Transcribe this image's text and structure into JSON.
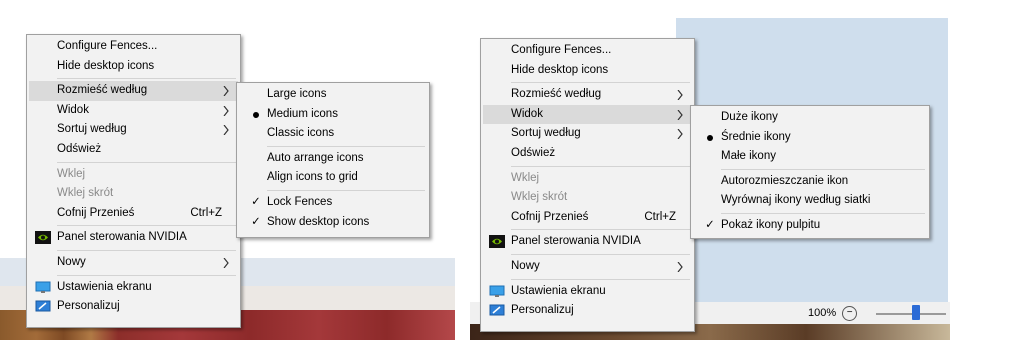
{
  "left": {
    "main_menu": {
      "configure": "Configure Fences...",
      "hide_icons": "Hide desktop icons",
      "sort_by_size": "Rozmieść według",
      "view": "Widok",
      "sort_by": "Sortuj według",
      "refresh": "Odśwież",
      "paste": "Wklej",
      "paste_shortcut": "Wklej skrót",
      "undo_move": "Cofnij Przenieś",
      "undo_shortcut": "Ctrl+Z",
      "nvidia": "Panel sterowania NVIDIA",
      "new": "Nowy",
      "display_settings": "Ustawienia ekranu",
      "personalize": "Personalizuj"
    },
    "submenu": {
      "large": "Large icons",
      "medium": "Medium icons",
      "classic": "Classic icons",
      "auto_arrange": "Auto arrange icons",
      "align_grid": "Align icons to grid",
      "lock_fences": "Lock Fences",
      "show_desktop": "Show desktop icons",
      "check_mark": "✓"
    }
  },
  "right": {
    "main_menu": {
      "configure": "Configure Fences...",
      "hide_icons": "Hide desktop icons",
      "sort_by_size": "Rozmieść według",
      "view": "Widok",
      "sort_by": "Sortuj według",
      "refresh": "Odśwież",
      "paste": "Wklej",
      "paste_shortcut": "Wklej skrót",
      "undo_move": "Cofnij Przenieś",
      "undo_shortcut": "Ctrl+Z",
      "nvidia": "Panel sterowania NVIDIA",
      "new": "Nowy",
      "display_settings": "Ustawienia ekranu",
      "personalize": "Personalizuj"
    },
    "submenu": {
      "large": "Duże ikony",
      "medium": "Średnie ikony",
      "small": "Małe ikony",
      "auto_arrange": "Autorozmieszczanie ikon",
      "align_grid": "Wyrównaj ikony według siatki",
      "show_desktop": "Pokaż ikony pulpitu",
      "check_mark": "✓"
    },
    "zoom": {
      "level": "100%",
      "minus": "−"
    }
  },
  "colors": {
    "highlight": "#dadada",
    "menu_bg": "#f2f2f2",
    "nvidia_green": "#76b900",
    "slider_thumb": "#2b6bd6"
  }
}
